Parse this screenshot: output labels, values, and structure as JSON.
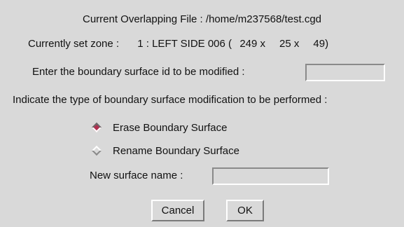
{
  "dialog": {
    "current_file_label": "Current Overlapping File :",
    "current_file_value": "/home/m237568/test.cgd",
    "zone_label": "Currently set zone :",
    "zone_id": "1",
    "zone_name": "LEFT SIDE 006",
    "zone_dims": [
      "249",
      "25",
      "49"
    ],
    "boundary_prompt": "Enter the boundary surface id to be modified :",
    "boundary_id_value": "",
    "modification_prompt": "Indicate the type of boundary surface modification to be performed :",
    "options": [
      {
        "label": "Erase Boundary Surface",
        "selected": true
      },
      {
        "label": "Rename Boundary Surface",
        "selected": false
      }
    ],
    "new_name_label": "New surface name :",
    "new_name_value": "",
    "cancel_label": "Cancel",
    "ok_label": "OK"
  },
  "colors": {
    "background": "#d9d9d9",
    "radio_selected": "#b03050"
  }
}
